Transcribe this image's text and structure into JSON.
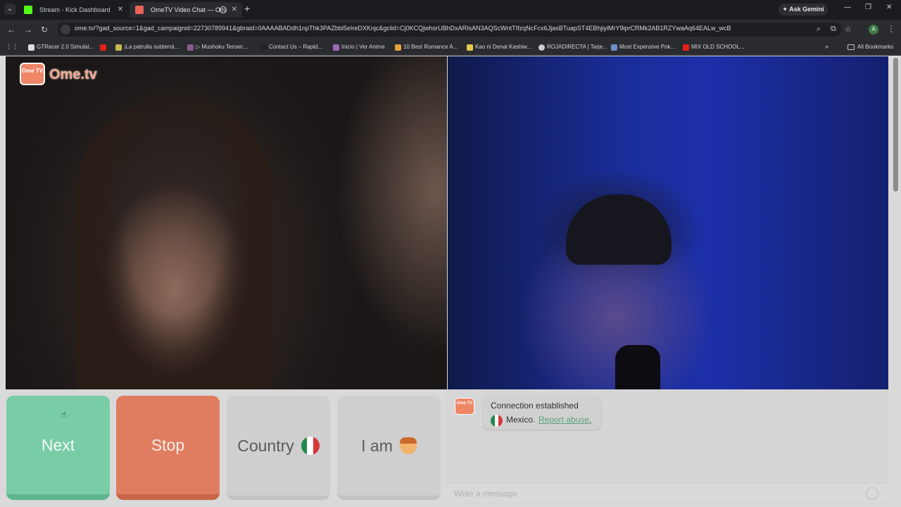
{
  "browser": {
    "tabs": [
      {
        "title": "Stream - Kick Dashboard"
      },
      {
        "title": "OmeTV Video Chat — Om"
      }
    ],
    "ask_gemini": "Ask Gemini",
    "url": "ome.tv/?gad_source=1&gad_campaignid=22730789941&gbraid=0AAAABADdh1npThk3PAZbbl5eIreDXKnjc&gclid=Cj0KCQjwhsrUBhDxARIsAN3AQScWntTIfzqNcFcx6JjasBTuapST4EBhjiyiMrY9iprCRMk2AB1RZYwaAq64EALw_wcB",
    "profile_initial": "A",
    "bookmarks": [
      "GTRacer 2.0 Simulat...",
      "¡La patrulla subterrá...",
      "▷ Mushoku Tensei:...",
      "Contact Us – Rapid...",
      "Inicio | Ver Anime",
      "10 Best Romance A...",
      "Kao ni Denai Kashiw...",
      "ROJADIRECTA | Tarje...",
      "Most Expensive Pok...",
      "MIX OLD SCHOOL..."
    ],
    "all_bookmarks": "All Bookmarks"
  },
  "app": {
    "logo_text": "Ome.tv",
    "logo_badge": "Ome TV",
    "buttons": {
      "next": "Next",
      "stop": "Stop",
      "country": "Country",
      "i_am": "I am"
    },
    "chat": {
      "status": "Connection established",
      "country": "Mexico.",
      "report": "Report abuse",
      "report_suffix": ".",
      "placeholder": "Write a message"
    }
  },
  "colors": {
    "next": "#78cca6",
    "stop": "#e07d61",
    "accent": "#ef8666"
  }
}
